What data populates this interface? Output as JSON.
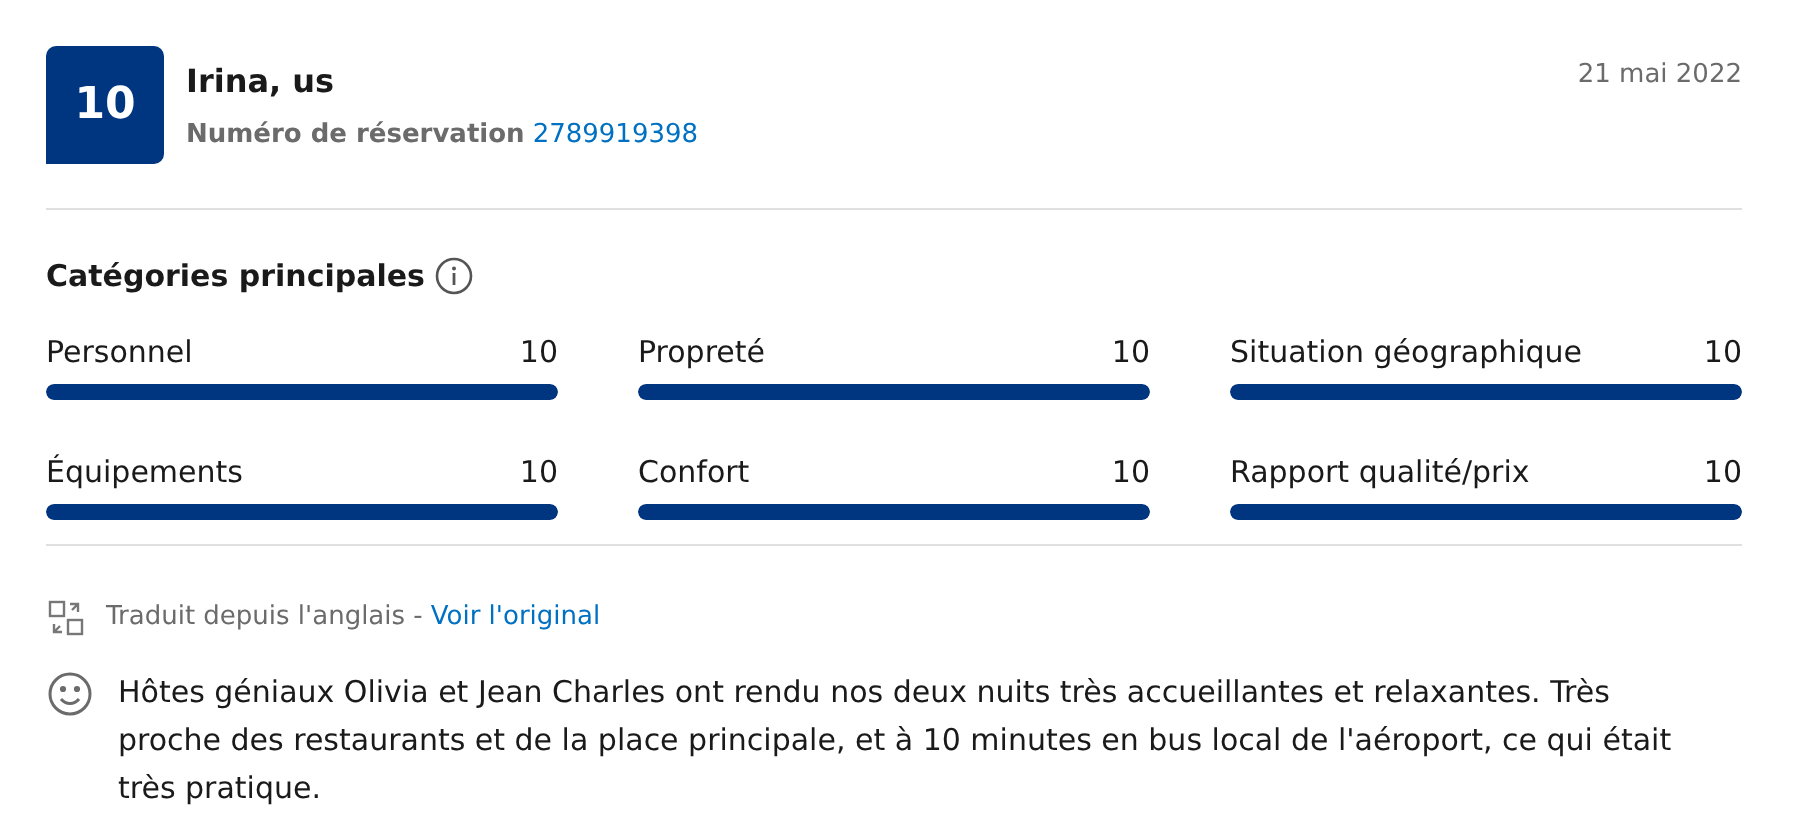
{
  "review": {
    "score": "10",
    "reviewer": "Irina, us",
    "booking_label": "Numéro de réservation",
    "booking_number": "2789919398",
    "date": "21 mai 2022"
  },
  "categories": {
    "title": "Catégories principales",
    "items": [
      {
        "label": "Personnel",
        "score": "10",
        "level": 1
      },
      {
        "label": "Propreté",
        "score": "10",
        "level": 1
      },
      {
        "label": "Situation géographique",
        "score": "10",
        "level": 1
      },
      {
        "label": "Équipements",
        "score": "10",
        "level": 1
      },
      {
        "label": "Confort",
        "score": "10",
        "level": 1
      },
      {
        "label": "Rapport qualité/prix",
        "score": "10",
        "level": 1
      }
    ]
  },
  "translation": {
    "note": "Traduit depuis l'anglais -",
    "link": "Voir l'original"
  },
  "comment": {
    "text": "Hôtes géniaux Olivia et Jean Charles ont rendu nos deux nuits très accueillantes et relaxantes. Très proche des restaurants et de la place principale, et à 10 minutes en bus local de l'aéroport, ce qui était très pratique."
  }
}
